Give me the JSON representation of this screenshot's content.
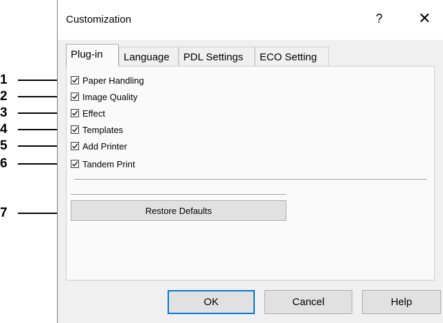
{
  "dialog": {
    "title": "Customization",
    "help_symbol": "?",
    "close_symbol": "✕"
  },
  "tabs": [
    {
      "label": "Plug-in",
      "active": true
    },
    {
      "label": "Language",
      "active": false
    },
    {
      "label": "PDL Settings",
      "active": false
    },
    {
      "label": "ECO Setting",
      "active": false
    }
  ],
  "checkboxes": [
    {
      "label": "Paper Handling",
      "checked": true
    },
    {
      "label": "Image Quality",
      "checked": true
    },
    {
      "label": "Effect",
      "checked": true
    },
    {
      "label": "Templates",
      "checked": true
    },
    {
      "label": "Add Printer",
      "checked": true
    },
    {
      "label": "Tandem Print",
      "checked": true
    }
  ],
  "restore_button": {
    "label": "Restore Defaults"
  },
  "footer": {
    "ok_label": "OK",
    "cancel_label": "Cancel",
    "help_label": "Help"
  },
  "callouts": [
    "1",
    "2",
    "3",
    "4",
    "5",
    "6",
    "7"
  ]
}
